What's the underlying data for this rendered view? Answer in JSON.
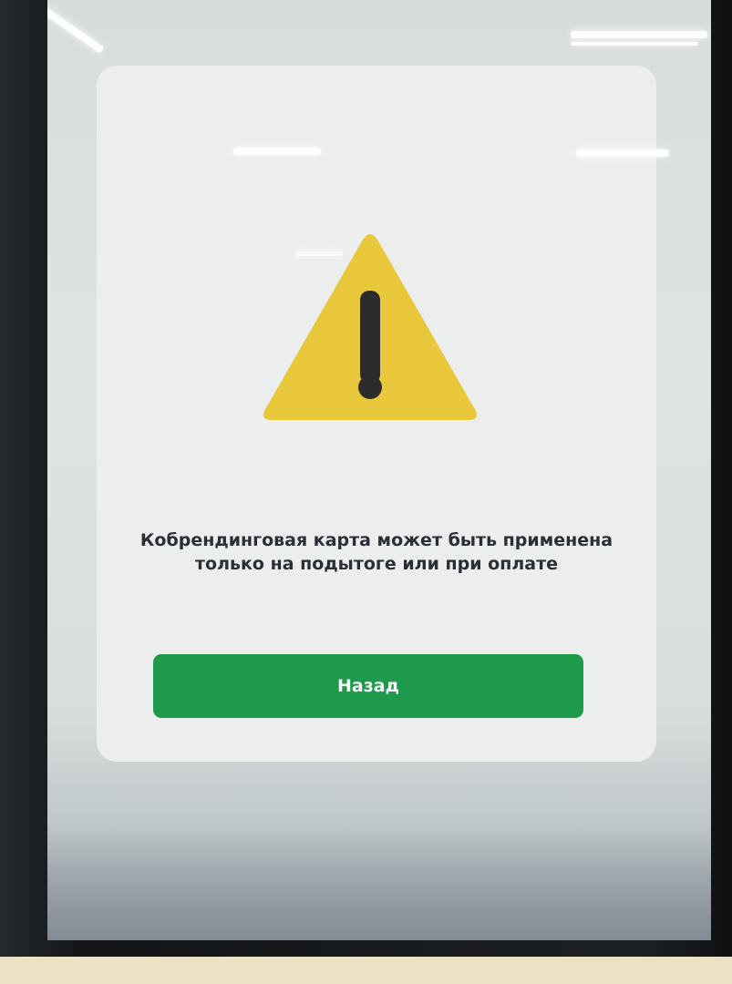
{
  "dialog": {
    "icon": "warning-triangle-icon",
    "message": "Кобрендинговая карта может быть применена только на подытоге или при оплате",
    "back_label": "Назад"
  },
  "colors": {
    "warning_yellow": "#e9c73a",
    "warning_mark": "#2c2c2c",
    "button_green": "#1e9a4c",
    "message_text": "#2a2f36",
    "dialog_bg": "#eceeed"
  }
}
